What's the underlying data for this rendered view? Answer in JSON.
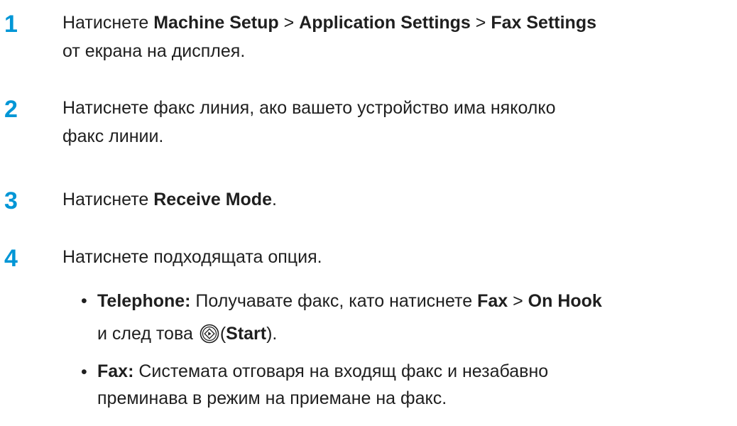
{
  "colors": {
    "accent": "#0096d6",
    "text": "#1f1f1f"
  },
  "steps": [
    {
      "number": "1",
      "prefix": "Натиснете ",
      "menu1": "Machine Setup",
      "sep1": " > ",
      "menu2": "Application Settings",
      "sep2": " > ",
      "menu3": "Fax Settings",
      "line2": "от екрана на дисплея."
    },
    {
      "number": "2",
      "line1": "Натиснете факс линия, ако вашето устройство има няколко",
      "line2": "факс линии."
    },
    {
      "number": "3",
      "prefix": "Натиснете ",
      "bold": "Receive Mode",
      "suffix": "."
    },
    {
      "number": "4",
      "text": "Натиснете подходящата опция."
    }
  ],
  "options": [
    {
      "bullet": "•",
      "term": "Telephone:",
      "desc": " Получавате факс, като натиснете ",
      "key1": "Fax",
      "sep": " > ",
      "key2": "On Hook",
      "line2_prefix": "и след това ",
      "icon": "start-button-icon",
      "paren_open": "(",
      "key3": "Start",
      "paren_close": ")."
    },
    {
      "bullet": "•",
      "term": "Fax:",
      "desc": " Системата отговаря на входящ факс и незабавно",
      "line2": "преминава в режим на приемане на факс."
    }
  ]
}
